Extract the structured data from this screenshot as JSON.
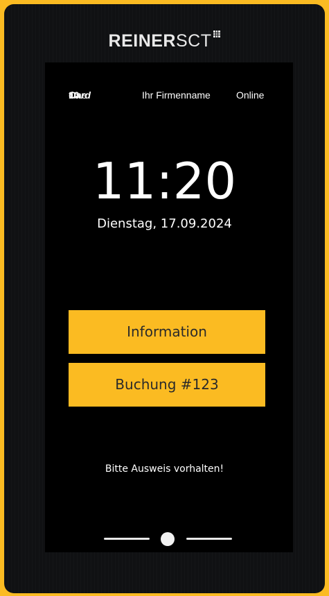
{
  "brand": {
    "name_bold": "REINER",
    "name_light": "SCT"
  },
  "status_bar": {
    "app_prefix": "time",
    "app_card": "Card",
    "app_version": " 10",
    "company": "Ihr Firmenname",
    "connection": "Online"
  },
  "clock": {
    "time": "11:20",
    "date": "Dienstag, 17.09.2024"
  },
  "buttons": {
    "information": "Information",
    "booking": "Buchung #123"
  },
  "prompt": "Bitte Ausweis vorhalten!",
  "icons": [
    "reiner-sct-logo-icon",
    "home-indicator-icon"
  ],
  "colors": {
    "accent": "#fbbb22",
    "screen": "#000000",
    "text": "#ffffff"
  }
}
